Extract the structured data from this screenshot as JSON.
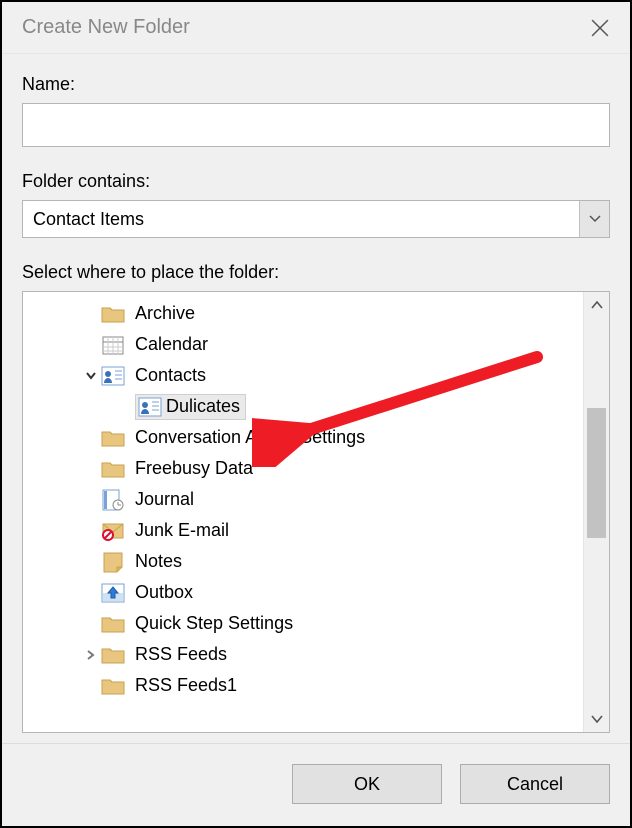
{
  "dialog": {
    "title": "Create New Folder",
    "name_label": "Name:",
    "name_value": "",
    "contains_label": "Folder contains:",
    "contains_value": "Contact Items",
    "place_label": "Select where to place the folder:",
    "ok": "OK",
    "cancel": "Cancel"
  },
  "tree": {
    "items": [
      {
        "label": "Archive",
        "icon": "folder",
        "indent": 1,
        "expander": ""
      },
      {
        "label": "Calendar",
        "icon": "calendar",
        "indent": 1,
        "expander": ""
      },
      {
        "label": "Contacts",
        "icon": "contact",
        "indent": 1,
        "expander": "open"
      },
      {
        "label": "Dulicates",
        "icon": "contact",
        "indent": 2,
        "expander": "",
        "selected": true
      },
      {
        "label": "Conversation Action Settings",
        "icon": "folder",
        "indent": 1,
        "expander": ""
      },
      {
        "label": "Freebusy Data",
        "icon": "folder",
        "indent": 1,
        "expander": ""
      },
      {
        "label": "Journal",
        "icon": "journal",
        "indent": 1,
        "expander": ""
      },
      {
        "label": "Junk E-mail",
        "icon": "junk",
        "indent": 1,
        "expander": ""
      },
      {
        "label": "Notes",
        "icon": "notes",
        "indent": 1,
        "expander": ""
      },
      {
        "label": "Outbox",
        "icon": "outbox",
        "indent": 1,
        "expander": ""
      },
      {
        "label": "Quick Step Settings",
        "icon": "folder",
        "indent": 1,
        "expander": ""
      },
      {
        "label": "RSS Feeds",
        "icon": "folder",
        "indent": 1,
        "expander": "closed"
      },
      {
        "label": "RSS Feeds1",
        "icon": "folder",
        "indent": 1,
        "expander": "",
        "cut": true
      }
    ]
  }
}
